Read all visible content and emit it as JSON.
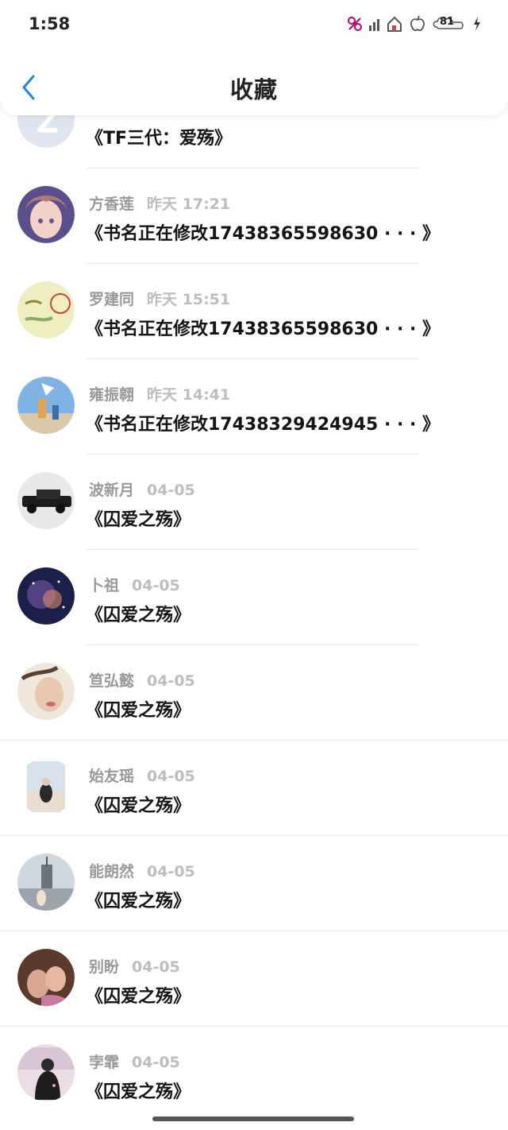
{
  "status_bar": {
    "time": "1:58",
    "battery": "81"
  },
  "header": {
    "title": "收藏"
  },
  "items": [
    {
      "author": "",
      "date": "",
      "title": "《TF三代：爱殇》",
      "avatar": "default-logo"
    },
    {
      "author": "方香莲",
      "date": "昨天 17:21",
      "title": "《书名正在修改17438365598630 · · · 》",
      "avatar": "anime-girl"
    },
    {
      "author": "罗建同",
      "date": "昨天 15:51",
      "title": "《书名正在修改17438365598630 · · · 》",
      "avatar": "yellow-sketch"
    },
    {
      "author": "雍振翱",
      "date": "昨天 14:41",
      "title": "《书名正在修改17438329424945 · · · 》",
      "avatar": "beach-kids"
    },
    {
      "author": "波新月",
      "date": "04-05",
      "title": "《囚爱之殇》",
      "avatar": "vintage-car"
    },
    {
      "author": "卜祖",
      "date": "04-05",
      "title": "《囚爱之殇》",
      "avatar": "galaxy"
    },
    {
      "author": "笪弘懿",
      "date": "04-05",
      "title": "《囚爱之殇》",
      "avatar": "girl-face"
    },
    {
      "author": "始友瑶",
      "date": "04-05",
      "title": "《囚爱之殇》",
      "avatar": "beach-girl"
    },
    {
      "author": "能朗然",
      "date": "04-05",
      "title": "《囚爱之殇》",
      "avatar": "pier"
    },
    {
      "author": "别盼",
      "date": "04-05",
      "title": "《囚爱之殇》",
      "avatar": "two-people"
    },
    {
      "author": "孛霏",
      "date": "04-05",
      "title": "《囚爱之殇》",
      "avatar": "girl-hoodie"
    }
  ]
}
